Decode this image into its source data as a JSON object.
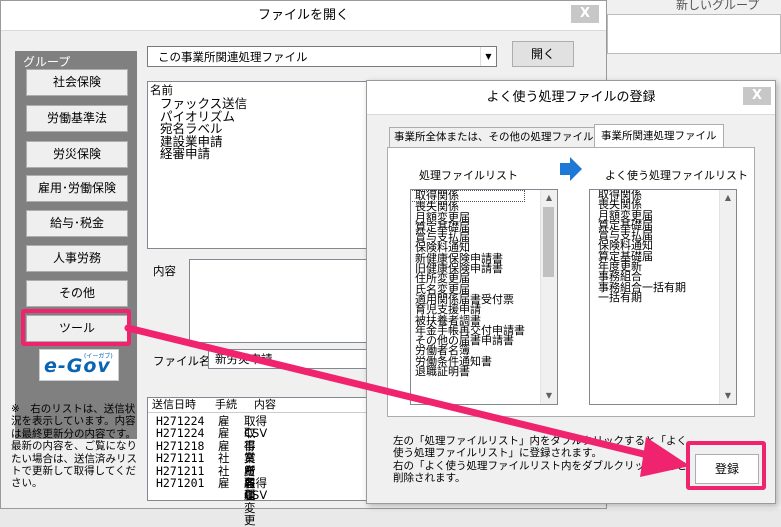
{
  "bg": {
    "right_title": "新しいグループ"
  },
  "dialog1": {
    "title": "ファイルを開く",
    "close": "X",
    "group_label": "グループ",
    "groups": [
      "社会保険",
      "労働基準法",
      "労災保険",
      "雇用･労働保険",
      "給与･税金",
      "人事労務",
      "その他",
      "ツール"
    ],
    "combo_value": "この事業所関連処理ファイル",
    "open_button": "開く",
    "list_header": "名前",
    "files": [
      "ファックス送信",
      "パイオリズム",
      "宛名ラベル",
      "建設業申請",
      "経審申請"
    ],
    "content_label": "内容",
    "filename_label": "ファイル名",
    "filename_value": "新労災申請",
    "egov_logo": "e-Gov",
    "egov_small": "(イーガブ)",
    "note": "※　右のリストは、送信状況を表示しています。内容は最終更新分の内容です。最新の内容を、ご覧になりたい場合は、送信済みリストで更新して取得してください。",
    "send_table": {
      "headers": [
        "送信日時",
        "手続",
        "内容"
      ],
      "rows": [
        [
          "H271224",
          "雇",
          "取得CSV"
        ],
        [
          "H271224",
          "雇",
          "取得"
        ],
        [
          "H271218",
          "雇",
          "事業所各種変更"
        ],
        [
          "H271211",
          "社",
          "賞与届"
        ],
        [
          "H271211",
          "社",
          "賞与届"
        ],
        [
          "H271201",
          "雇",
          "取得CSV"
        ]
      ]
    }
  },
  "dialog2": {
    "title": "よく使う処理ファイルの登録",
    "close": "X",
    "tab_all": "事業所全体または、その他の処理ファイル",
    "tab_office": "事業所関連処理ファイル",
    "left_list_label": "処理ファイルリスト",
    "right_list_label": "よく使う処理ファイルリスト",
    "left_items": [
      "取得関係",
      "喪失関係",
      "月額変更届",
      "算定基礎届",
      "賞与支払届",
      "保険料通知",
      "新健康保険申請書",
      "旧健康保険申請書",
      "住所変更届",
      "氏名変更届",
      "適用関係届書受付票",
      "育児支援申請",
      "被扶養者調書",
      "年金手帳再交付申請書",
      "その他の届書申請書",
      "労働者名簿",
      "労働条件通知書",
      "退職証明書"
    ],
    "right_items": [
      "取得関係",
      "喪失関係",
      "月額変更届",
      "算定基礎届",
      "賞与支払届",
      "保険料通知",
      "算定基礎届",
      "年度更新",
      "事務組合",
      "事務組合一括有期",
      "一括有期"
    ],
    "help_line1": "左の「処理ファイルリスト」内をダブルクリックすると「よく使う処理ファイルリスト」に登録されます。",
    "help_line2": "右の「よく使う処理ファイルリスト内をダブルクリックすると削除されます。",
    "register_button": "登録"
  },
  "colors": {
    "highlight": "#f0246e",
    "group_panel": "#808080",
    "arrow_blue": "#1e78d6"
  }
}
